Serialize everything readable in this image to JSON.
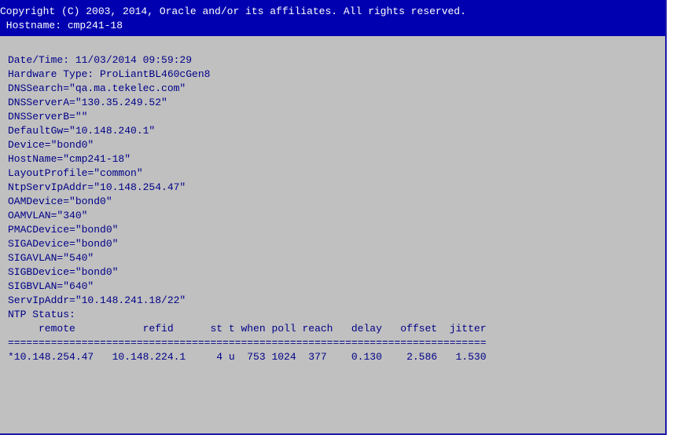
{
  "header": {
    "copyright": "Copyright (C) 2003, 2014, Oracle and/or its affiliates. All rights reserved.",
    "hostname": " Hostname: cmp241-18"
  },
  "config": {
    "datetime": "Date/Time: 11/03/2014 09:59:29",
    "hardware": "Hardware Type: ProLiantBL460cGen8",
    "dnssearch": "DNSSearch=\"qa.ma.tekelec.com\"",
    "dnsservera": "DNSServerA=\"130.35.249.52\"",
    "dnsserverb": "DNSServerB=\"\"",
    "defaultgw": "DefaultGw=\"10.148.240.1\"",
    "device": "Device=\"bond0\"",
    "hostname": "HostName=\"cmp241-18\"",
    "layoutprofile": "LayoutProfile=\"common\"",
    "ntpservipaddr": "NtpServIpAddr=\"10.148.254.47\"",
    "oamdevice": "OAMDevice=\"bond0\"",
    "oamvlan": "OAMVLAN=\"340\"",
    "pmacdevice": "PMACDevice=\"bond0\"",
    "sigadevice": "SIGADevice=\"bond0\"",
    "sigavlan": "SIGAVLAN=\"540\"",
    "sigbdevice": "SIGBDevice=\"bond0\"",
    "sigbvlan": "SIGBVLAN=\"640\"",
    "servipaddr": "ServIpAddr=\"10.148.241.18/22\""
  },
  "ntp": {
    "status_label": "NTP Status:",
    "columns": "     remote           refid      st t when poll reach   delay   offset  jitter",
    "separator": "==============================================================================",
    "row": "*10.148.254.47   10.148.224.1     4 u  753 1024  377    0.130    2.586   1.530"
  }
}
